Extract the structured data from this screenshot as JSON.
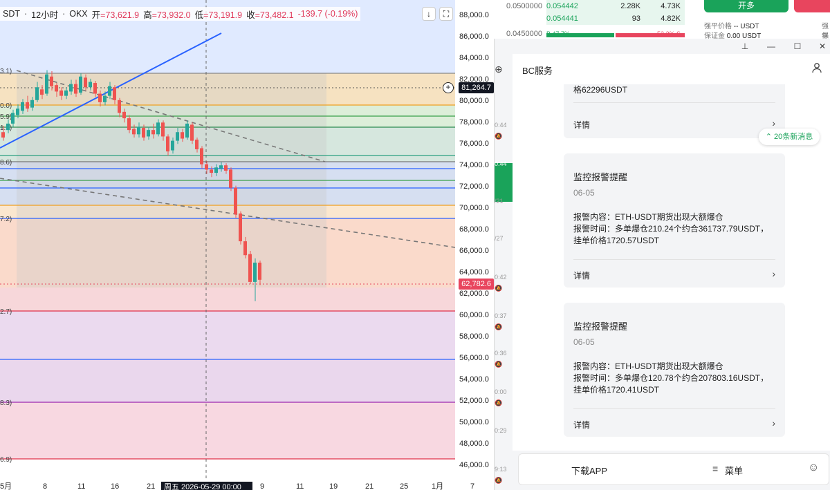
{
  "chart": {
    "symbol_part": "SDT",
    "sep1": "·",
    "timeframe": "12小时",
    "sep2": "·",
    "exchange": "OKX",
    "open_label": "开",
    "open_value": "=73,621.9",
    "high_label": "高",
    "high_value": "=73,932.0",
    "low_label": "低",
    "low_value": "=73,191.9",
    "close_label": "收",
    "close_value": "=73,482.1",
    "change_value": "-139.7 (-0.19%)",
    "download_icon": "↓",
    "fullscreen_icon": "⛶",
    "current_price_tag": "81,264.7",
    "last_price_tag": "62,782.6",
    "crosshair_date_label": "周五 2026-05-29 00:00",
    "y_ticks": [
      "88,000.0",
      "86,000.0",
      "84,000.0",
      "82,000.0",
      "80,000.0",
      "78,000.0",
      "76,000.0",
      "74,000.0",
      "72,000.0",
      "70,000.0",
      "68,000.0",
      "66,000.0",
      "64,000.0",
      "62,000.0",
      "60,000.0",
      "58,000.0",
      "56,000.0",
      "54,000.0",
      "52,000.0",
      "50,000.0",
      "48,000.0",
      "46,000.0"
    ],
    "x_ticks": [
      "5月",
      "8",
      "11",
      "16",
      "21",
      "周五 2026-05-29 00:00",
      "9",
      "11",
      "19",
      "21",
      "25",
      "1月",
      "7"
    ],
    "fib_labels": [
      "3.1)",
      "0.0)",
      "5.9)",
      "1.7)",
      "8.6)",
      "7.2)",
      "2.7)",
      "8.3)",
      "6.9)"
    ],
    "colors": {
      "up": "#26a69a",
      "down": "#ef5350",
      "price_tag_current": "#131722",
      "price_tag_last": "#e8455e",
      "trend": "#2962ff"
    }
  },
  "chart_data": {
    "type": "candlestick",
    "ylim": [
      45000,
      89000
    ],
    "candles_close_hint": [
      80000,
      79800,
      80400,
      82500,
      81000,
      81500,
      82600,
      81200,
      80300,
      79000,
      77800,
      77000,
      76000,
      75300,
      74200,
      73400,
      73700,
      73900,
      73482,
      71400,
      69000,
      67500,
      66800,
      64800,
      62782
    ]
  },
  "trade_strip": {
    "price_a": "0.0500000",
    "price_b": "0.0450000",
    "rows": [
      {
        "price": "0.054442",
        "qty": "2.28K",
        "total": "4.73K"
      },
      {
        "price": "0.054441",
        "qty": "93",
        "total": "4.82K"
      }
    ],
    "ratio_left": "B 47.7%",
    "ratio_right": "52.3% S",
    "open_button": "开多",
    "liq_label": "强平价格",
    "liq_value": "-- USDT",
    "margin_label": "保证金",
    "margin_value": "0.00 USDT",
    "liq_label_2": "强平",
    "margin_label_2": "保证"
  },
  "window": {
    "pin_icon": "⊥",
    "minimize_icon": "—",
    "maximize_icon": "☐",
    "close_icon": "✕",
    "add_icon": "⊕",
    "title": "BC服务",
    "user_icon": "👤",
    "rail_times": [
      "0:44",
      "0:44",
      "/21",
      "/27",
      "0:42",
      "0:37",
      "0:36",
      "0:00",
      "0:29",
      "9:13"
    ],
    "new_message_badge": "20条新消息",
    "card0": {
      "line": "格62296USDT",
      "detail": "详情"
    },
    "card1": {
      "title": "监控报警提醒",
      "date": "06-05",
      "line1": "报警内容：ETH-USDT期货出现大额爆仓",
      "line2": "报警时间：多单爆仓210.24个约合361737.79USDT，",
      "line3": "挂单价格1720.57USDT",
      "detail": "详情"
    },
    "card2": {
      "title": "监控报警提醒",
      "date": "06-05",
      "line1": "报警内容：ETH-USDT期货出现大额爆仓",
      "line2": "报警时间：多单爆仓120.78个约合207803.16USDT，",
      "line3": "挂单价格1720.41USDT",
      "detail": "详情"
    },
    "bottom": {
      "download": "下载APP",
      "menu_icon": "≡",
      "menu": "菜单",
      "service_icon": "☺"
    }
  }
}
